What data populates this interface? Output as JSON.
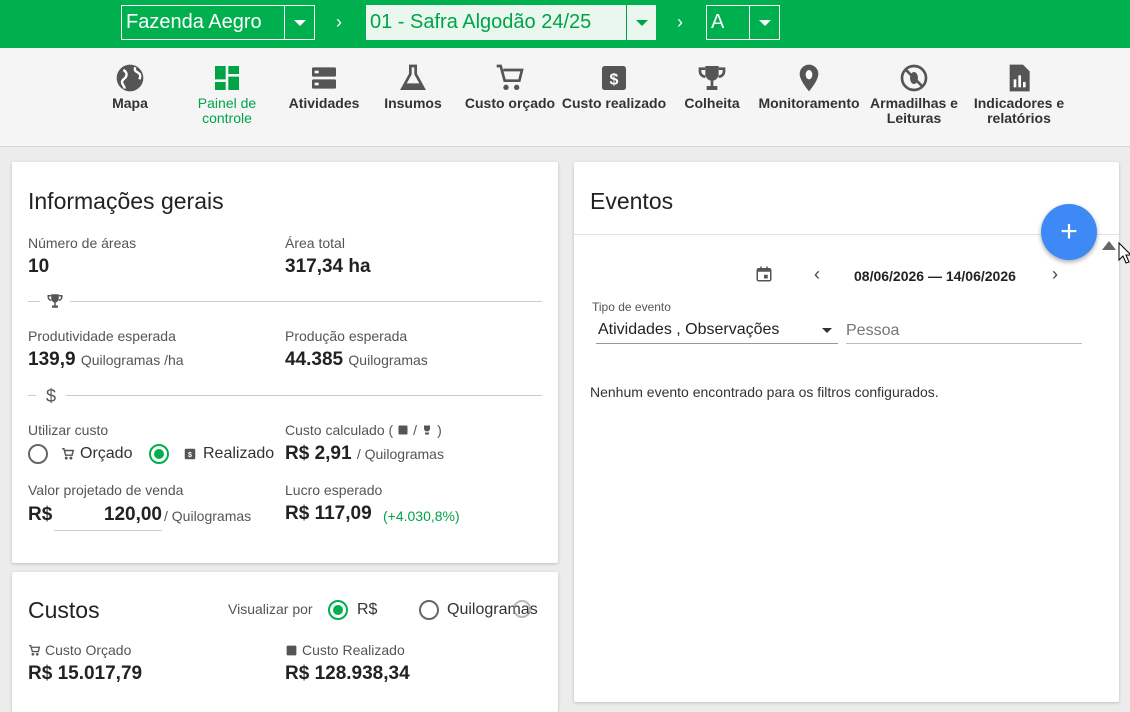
{
  "topbar": {
    "farm": "Fazenda Aegro",
    "crop": "01 - Safra Algodão 24/25",
    "plot": "A",
    "arrow": "›"
  },
  "nav": [
    {
      "label": "Mapa",
      "icon": "globe-icon"
    },
    {
      "label": "Painel de controle",
      "icon": "dashboard-icon",
      "active": true
    },
    {
      "label": "Atividades",
      "icon": "storage-icon"
    },
    {
      "label": "Insumos",
      "icon": "flask-icon"
    },
    {
      "label": "Custo orçado",
      "icon": "cart-icon"
    },
    {
      "label": "Custo realizado",
      "icon": "money-icon"
    },
    {
      "label": "Colheita",
      "icon": "trophy-icon"
    },
    {
      "label": "Monitoramento",
      "icon": "bug-pin-icon"
    },
    {
      "label": "Armadilhas e Leituras",
      "icon": "no-bug-icon"
    },
    {
      "label": "Indicadores e relatórios",
      "icon": "report-icon"
    }
  ],
  "info": {
    "title": "Informações gerais",
    "areas_label": "Número de áreas",
    "areas_value": "10",
    "total_area_label": "Área total",
    "total_area_value": "317,34 ha",
    "prod_label": "Produtividade esperada",
    "prod_value": "139,9",
    "prod_unit": "Quilogramas /ha",
    "production_label": "Produção esperada",
    "production_value": "44.385",
    "production_unit": "Quilogramas",
    "cost_use_label": "Utilizar custo",
    "cost_opt_budget": "Orçado",
    "cost_opt_realized": "Realizado",
    "calc_cost_label_a": "Custo calculado (",
    "calc_cost_label_sep": "/",
    "calc_cost_label_b": ")",
    "calc_cost_value": "R$ 2,91",
    "calc_cost_unit": "/ Quilogramas",
    "sale_label": "Valor projetado de venda",
    "sale_currency": "R$",
    "sale_value": "120,00",
    "sale_unit": "/ Quilogramas",
    "profit_label": "Lucro esperado",
    "profit_value": "R$ 117,09",
    "profit_pct": "(+4.030,8%)"
  },
  "costs": {
    "title": "Custos",
    "view_by": "Visualizar por",
    "opt_currency": "R$",
    "opt_kg": "Quilogramas",
    "budget_label": "Custo Orçado",
    "budget_value": "R$ 15.017,79",
    "realized_label": "Custo Realizado",
    "realized_value": "R$ 128.938,34"
  },
  "events": {
    "title": "Eventos",
    "fab": "+",
    "date_range": "08/06/2026 — 14/06/2026",
    "prev": "‹",
    "next": "›",
    "type_label": "Tipo de evento",
    "type_value": "Atividades , Observações",
    "person_placeholder": "Pessoa",
    "empty": "Nenhum evento encontrado para os filtros configurados."
  },
  "colors": {
    "brand": "#00b04f",
    "fab": "#3d8af7",
    "profit": "#00a447"
  }
}
